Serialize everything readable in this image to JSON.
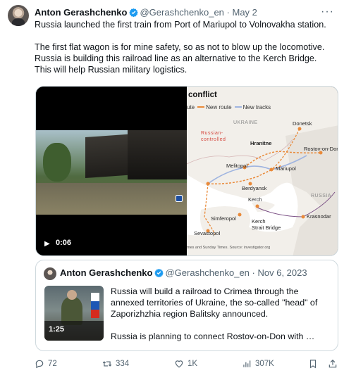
{
  "tweet": {
    "author_name": "Anton Gerashchenko",
    "author_handle": "@Gerashchenko_en",
    "separator": "·",
    "date": "May 2",
    "text": "Russia launched the first train from Port of Mariupol to Volnovakha station.\n\nThe first flat wagon is for mine safety, so as not to blow up the locomotive.\nRussia is building this railroad line as an alternative to the Kerch Bridge.\nThis will help Russian military logistics.",
    "more_label": "···"
  },
  "video": {
    "duration": "0:06",
    "play_icon": "play-icon"
  },
  "map": {
    "title": "conflict",
    "legend": [
      {
        "label": "ute"
      },
      {
        "label": "New route",
        "color": "#e98a3a"
      },
      {
        "label": "New tracks",
        "color": "#9fb4e0"
      }
    ],
    "regions": {
      "ukraine": "UKRAINE",
      "russian_controlled": "Russian-\ncontrolled",
      "russia": "RUSSIA"
    },
    "cities": {
      "donetsk": "Donetsk",
      "hranitne": "Hranitne",
      "rostov": "Rostov-on-Don",
      "melitopol": "Melitopol",
      "mariupol": "Mariupol",
      "berdyansk": "Berdyansk",
      "kerch": "Kerch",
      "simferopol": "Simferopol",
      "kerch_bridge": "Kerch\nStrait Bridge",
      "krasnodar": "Krasnodar",
      "sevastopol": "Sevastopol"
    },
    "source": "mes and Sunday Times. Source: investigator.org",
    "colors": {
      "route": "#e98a3a",
      "tracks": "#9fb4e0",
      "sea": "#ffffff",
      "land": "#f2efea",
      "russia_land": "#e6e2dc"
    }
  },
  "quote": {
    "author_name": "Anton Gerashchenko",
    "author_handle": "@Gerashchenko_en",
    "separator": "·",
    "date": "Nov 6, 2023",
    "text": "Russia will build a railroad to Crimea through the annexed territories of Ukraine, the so-called \"head\" of Zaporizhzhia region Balitsky announced.\n\nRussia is planning to connect Rostov-on-Don with …",
    "video_duration": "1:25"
  },
  "actions": {
    "replies": "72",
    "reposts": "334",
    "likes": "1K",
    "views": "307K"
  },
  "colors": {
    "accent": "#1d9bf0",
    "secondary_text": "#536471",
    "border": "#cfd9de"
  }
}
